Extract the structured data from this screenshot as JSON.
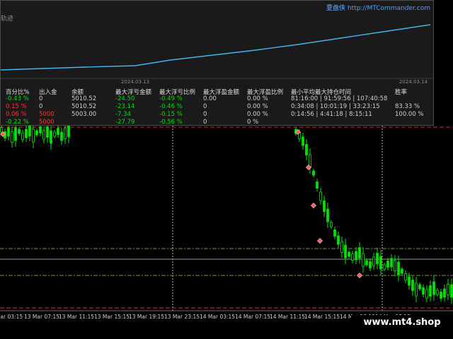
{
  "brand": {
    "name": "夏盘侠",
    "url": "http://MTCommander.com"
  },
  "equity_panel": {
    "label": "轨迹",
    "start_date": "2024.03.13",
    "end_date": "2024.03.14",
    "line_color": "#3fb7ee"
  },
  "stats": {
    "headers": [
      "百分比%",
      "出入金",
      "余额",
      "最大浮亏金额",
      "最大浮亏比例",
      "最大浮盈金额",
      "最大浮盈比例",
      "最小平均最大持仓时间",
      "胜率"
    ],
    "rows": [
      [
        "-0.43 %",
        "0",
        "5010.52",
        "-24.50",
        "-0.49 %",
        "0.00",
        "0.00 %",
        "81:16:00 | 91:59:56 | 107:40:58",
        ""
      ],
      [
        "0.15 %",
        "0",
        "5010.52",
        "-23.14",
        "-0.46 %",
        "0",
        "0.00 %",
        "0:34:08 | 10:01:19 | 33:23:15",
        "83.33 %"
      ],
      [
        "0.06 %",
        "5000",
        "5003.00",
        "-7.34",
        "-0.15 %",
        "0",
        "0.00 %",
        "0:14:56 | 4:41:18 | 8:15:11",
        "100.00 %"
      ],
      [
        "-0.22 %",
        "5000",
        "",
        "-27.79",
        "-0.56 %",
        "0",
        "0 %",
        "",
        ""
      ]
    ]
  },
  "xaxis_labels": [
    "Mar 03:15",
    "13 Mar 07:15",
    "13 Mar 11:15",
    "13 Mar 15:15",
    "13 Mar 19:15",
    "13 Mar 23:15",
    "14 Mar 03:15",
    "14 Mar 07:15",
    "14 Mar 11:15",
    "14 Mar 15:15",
    "14 Mar 19:15",
    "14 Mar 23:15"
  ],
  "watermark": "www.mt4.shop",
  "colors": {
    "bull": "#00e000",
    "bear": "#00e000",
    "grid": "#3a3a3a",
    "red_level": "#c83030",
    "green_level": "#6a9a3a"
  }
}
